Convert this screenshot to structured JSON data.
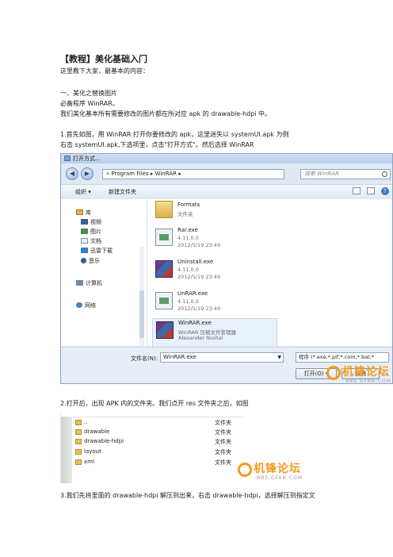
{
  "doc": {
    "title": "【教程】美化基础入门",
    "intro": "这里教下大家，最基本的内容：",
    "section_heading": "一、美化之替换图片",
    "required_tools": "必备程序 WinRAR。",
    "purpose": "我们美化基本所有需要修改的图片都在所对应 apk 的 drawable-hdpi 中。",
    "step1_line1": "1.首先如图，用 WinRAR 打开你要修改的 apk，这里迷失以 systemUI.apk 为例",
    "step1_line2": "右击 systemUI.apk,下选项里，点击\"打开方式\"。然后选择 WinRAR",
    "step2": "2.打开后，出现 APK 内的文件夹。我们点开 res 文件夹之后，如图",
    "step3": "3.我们先将里面的 drawable-hdpi 解压到出来，右击 drawable-hdpi，选择解压到指定文"
  },
  "dialog": {
    "window_title": "打开方式...",
    "address": "« Program Files ▸ WinRAR ▸",
    "search_placeholder": "搜索 WinRAR",
    "toolbar": {
      "organize": "组织 ▾",
      "new_folder": "新建文件夹"
    },
    "nav": {
      "library": "库",
      "video": "视频",
      "pictures": "图片",
      "documents": "文档",
      "downloads": "迅雷下载",
      "music": "音乐",
      "computer": "计算机",
      "network": "网络"
    },
    "files": [
      {
        "name": "Formats",
        "line1": "文件夹",
        "line2": ""
      },
      {
        "name": "Rar.exe",
        "line1": "4.11.0.0",
        "line2": "2012/5/19 23:49"
      },
      {
        "name": "Uninstall.exe",
        "line1": "4.11.0.0",
        "line2": "2012/5/19 23:49"
      },
      {
        "name": "UnRAR.exe",
        "line1": "4.11.0.0",
        "line2": "2012/5/19 23:49"
      },
      {
        "name": "WinRAR.exe",
        "line1": "WinRAR 压缩文件管理器",
        "line2": "Alexander Roshal"
      }
    ],
    "filename_label": "文件名(N):",
    "filename_value": "WinRAR.exe",
    "filter": "程序 (*.exe;*.pif;*.com;*.bat;*",
    "open_button": "打开(O) ▾",
    "cancel_button": "取消"
  },
  "list": {
    "rows": [
      {
        "name": "..",
        "type": "文件夹"
      },
      {
        "name": "drawable",
        "type": "文件夹"
      },
      {
        "name": "drawable-hdpi",
        "type": "文件夹"
      },
      {
        "name": "layout",
        "type": "文件夹"
      },
      {
        "name": "xml",
        "type": "文件夹"
      }
    ]
  },
  "watermark": {
    "text": "机锋论坛",
    "url": "BBS.GFAN.COM"
  },
  "colors": {
    "watermark": "#f29b1f",
    "dialog_bg": "#dfe9f5"
  }
}
